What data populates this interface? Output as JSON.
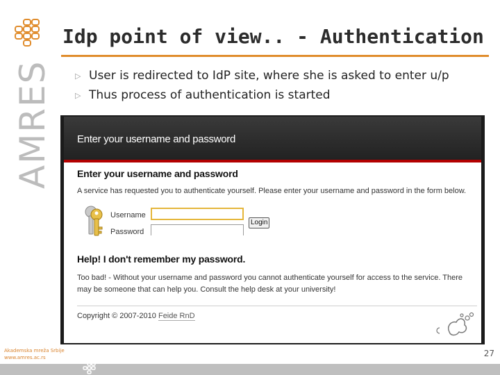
{
  "slide": {
    "title": "Idp point of view.. - Authentication",
    "bullets": [
      "User is redirected to IdP site, where she is asked to enter u/p",
      "Thus process of authentication is started"
    ],
    "logo_text": "AMRES",
    "footer_org": "Akademska mreža Srbije",
    "footer_url": "www.amres.ac.rs",
    "page_number": "27",
    "accent_color": "#e08c2c"
  },
  "login_page": {
    "header_title": "Enter your username and password",
    "heading": "Enter your username and password",
    "service_text": "A service has requested you to authenticate yourself. Please enter your username and password in the form below.",
    "username_label": "Username",
    "password_label": "Password",
    "username_value": "",
    "password_value": "",
    "login_button": "Login",
    "help_heading": "Help! I don't remember my password.",
    "help_text": "Too bad! - Without your username and password you cannot authenticate yourself for access to the service. There may be someone that can help you. Consult the help desk at your university!",
    "copyright_prefix": "Copyright © 2007-2010",
    "copyright_link": "Feide RnD",
    "header_accent_color": "#b30000"
  }
}
